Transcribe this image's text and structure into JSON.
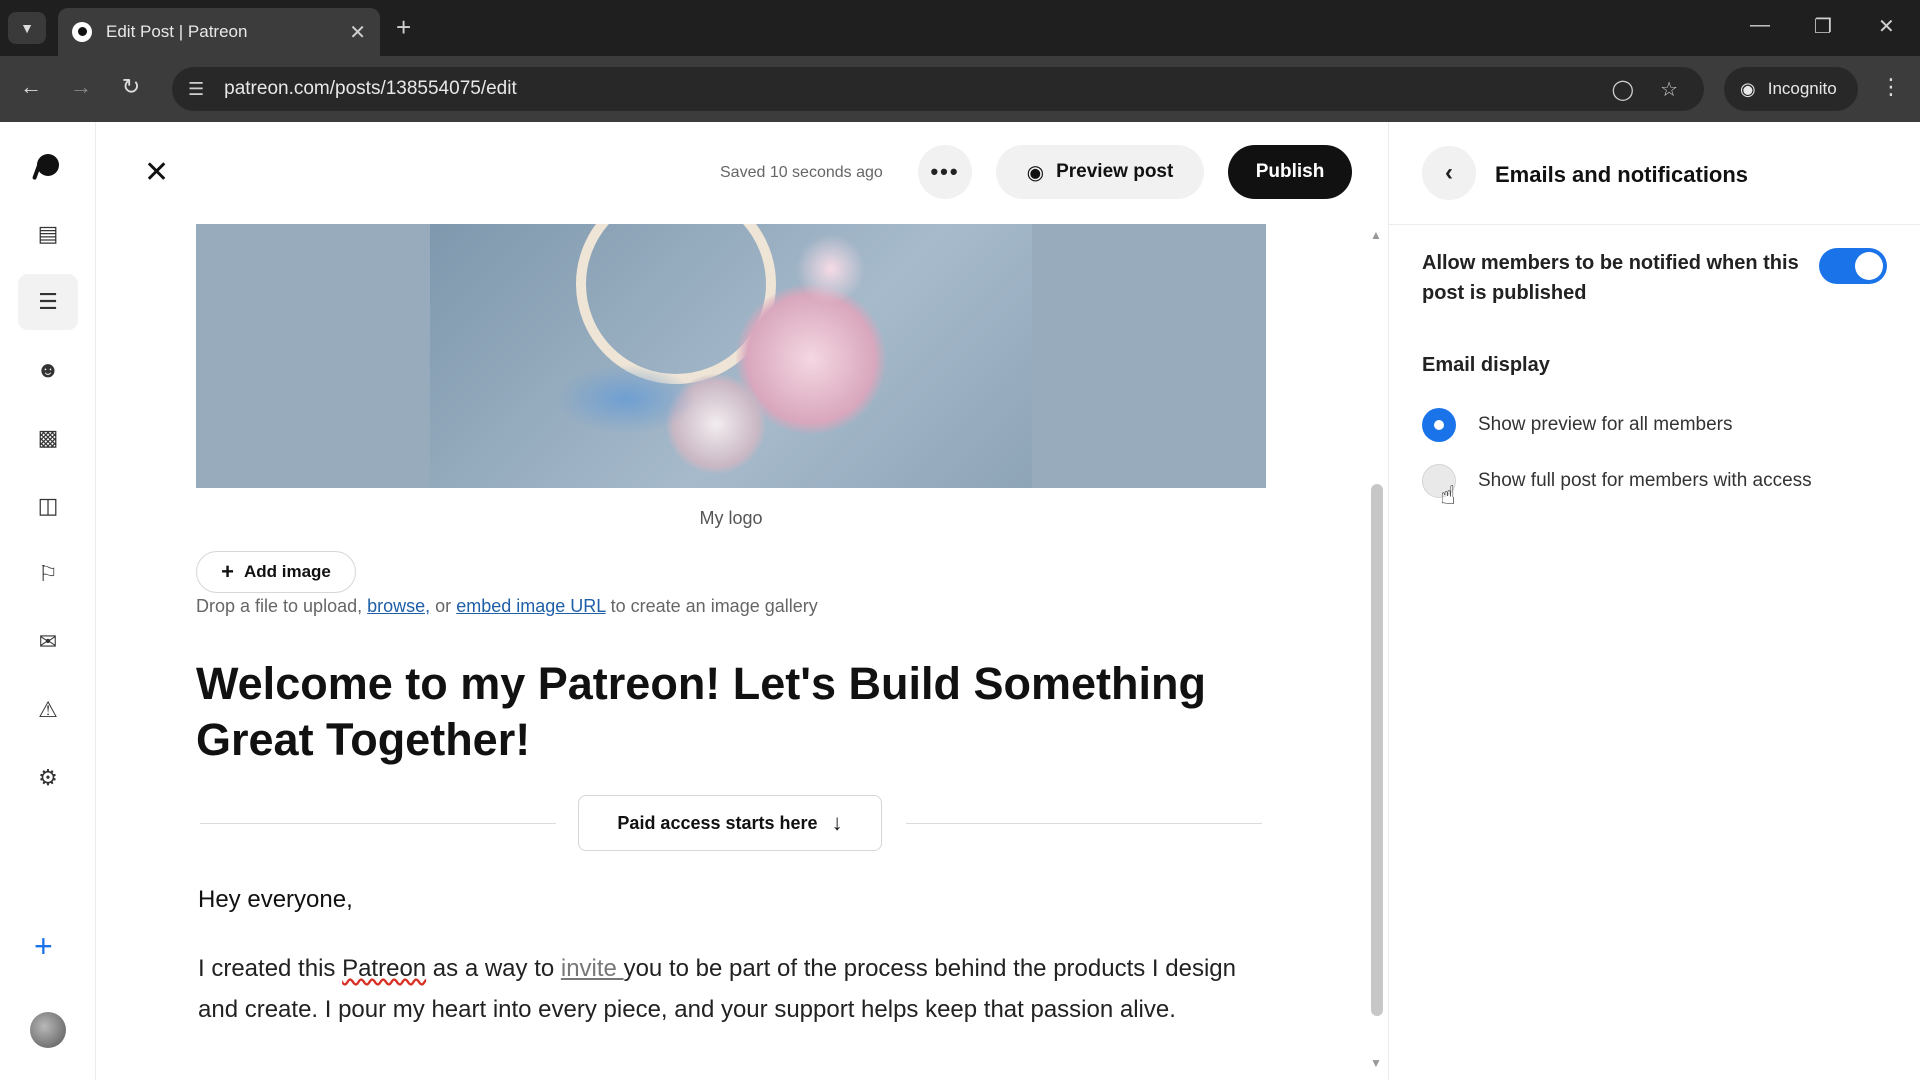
{
  "browser": {
    "tab_title": "Edit Post | Patreon",
    "url": "patreon.com/posts/138554075/edit",
    "incognito_label": "Incognito"
  },
  "editor": {
    "saved_status": "Saved 10 seconds ago",
    "more_label": "•••",
    "preview_label": "Preview post",
    "publish_label": "Publish",
    "image_caption": "My logo",
    "add_image_label": "Add image",
    "drop_hint_prefix": "Drop a file to upload,",
    "browse_link": "browse,",
    "drop_hint_or": "or",
    "embed_link": "embed image URL",
    "drop_hint_suffix": "to create an image gallery",
    "post_title": "Welcome to my Patreon! Let's Build Something Great Together!",
    "paid_access_label": "Paid access starts here",
    "greeting": "Hey everyone,",
    "body_part1": "I created this ",
    "body_spell": "Patreon",
    "body_part2": " as a way to ",
    "body_link": "invite ",
    "body_part3": "you to be part of the process behind the products I design and create. I pour my heart into every piece, and your support helps keep that passion alive."
  },
  "panel": {
    "title": "Emails and notifications",
    "notify_label": "Allow members to be notified when this post is published",
    "notify_enabled": true,
    "email_display_heading": "Email display",
    "options": [
      {
        "label": "Show preview for all members",
        "selected": true
      },
      {
        "label": "Show full post for members with access",
        "selected": false
      }
    ]
  },
  "colors": {
    "accent": "#1a73e8",
    "publish_bg": "#111111"
  }
}
